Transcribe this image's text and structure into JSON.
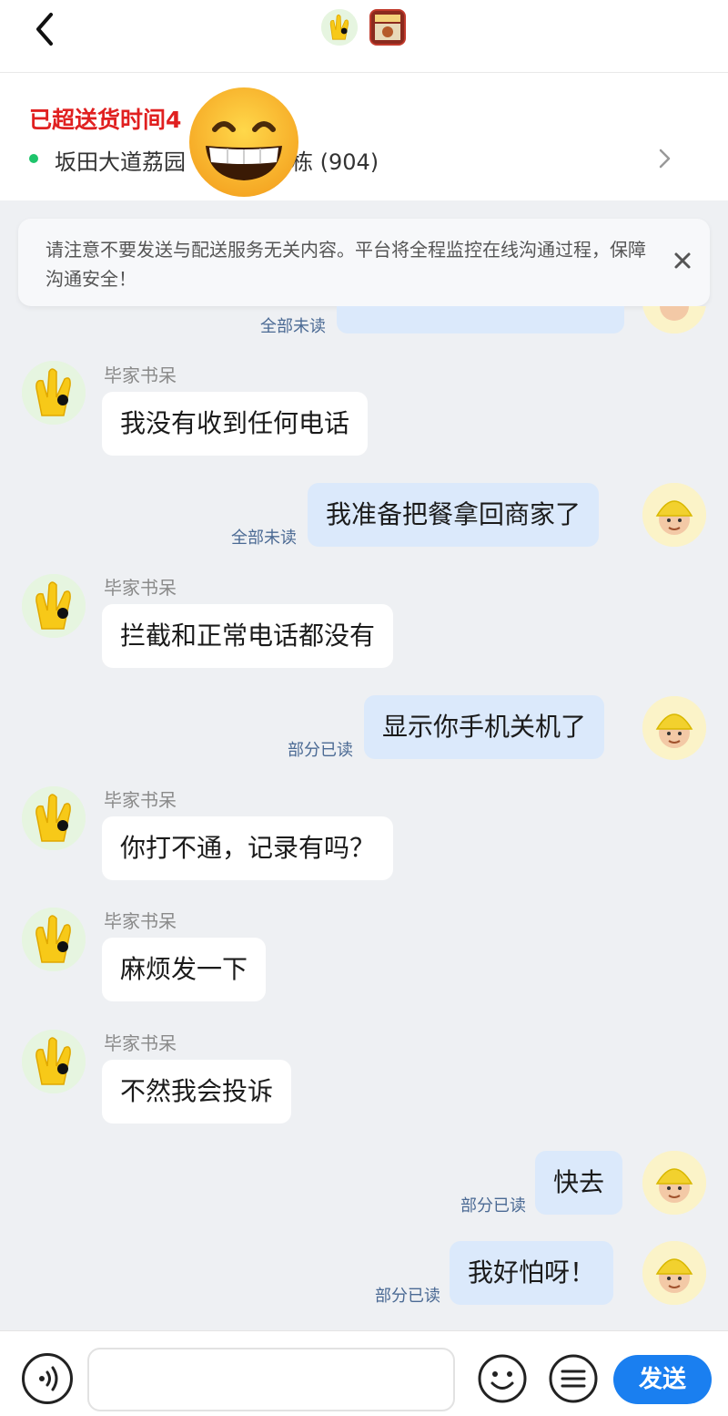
{
  "top_bar": {
    "back_icon": "chevron-left-icon",
    "customer_avatar_icon": "yellow-hand-avatar",
    "shop_avatar_icon": "shop-logo"
  },
  "order": {
    "overtime_text": "已超送货时间4",
    "address_text": "坂田大道荔园",
    "address_suffix": "栋 (904)",
    "status_color": "#1ec46b",
    "overtime_color": "#e02020"
  },
  "notice": {
    "text": "请注意不要发送与配送服务无关内容。平台将全程监控在线沟通过程，保障沟通安全！"
  },
  "chat": {
    "partial_top": {
      "read_status": "全部未读"
    },
    "messages": [
      {
        "side": "left",
        "sender": "毕家书呆",
        "text": "我没有收到任何电话"
      },
      {
        "side": "right",
        "text": "我准备把餐拿回商家了",
        "read_status": "全部未读"
      },
      {
        "side": "left",
        "sender": "毕家书呆",
        "text": "拦截和正常电话都没有"
      },
      {
        "side": "right",
        "text": "显示你手机关机了",
        "read_status": "部分已读"
      },
      {
        "side": "left",
        "sender": "毕家书呆",
        "text": "你打不通，记录有吗？"
      },
      {
        "side": "left",
        "sender": "毕家书呆",
        "text": "麻烦发一下"
      },
      {
        "side": "left",
        "sender": "毕家书呆",
        "text": "不然我会投诉"
      },
      {
        "side": "right",
        "text": "快去",
        "read_status": "部分已读"
      },
      {
        "side": "right",
        "text": "我好怕呀！",
        "read_status": "部分已读"
      }
    ]
  },
  "input_bar": {
    "voice_icon": "voice-icon",
    "emoji_icon": "emoji-icon",
    "more_icon": "menu-list-icon",
    "send_label": "发送",
    "send_color": "#1a7ff0"
  }
}
